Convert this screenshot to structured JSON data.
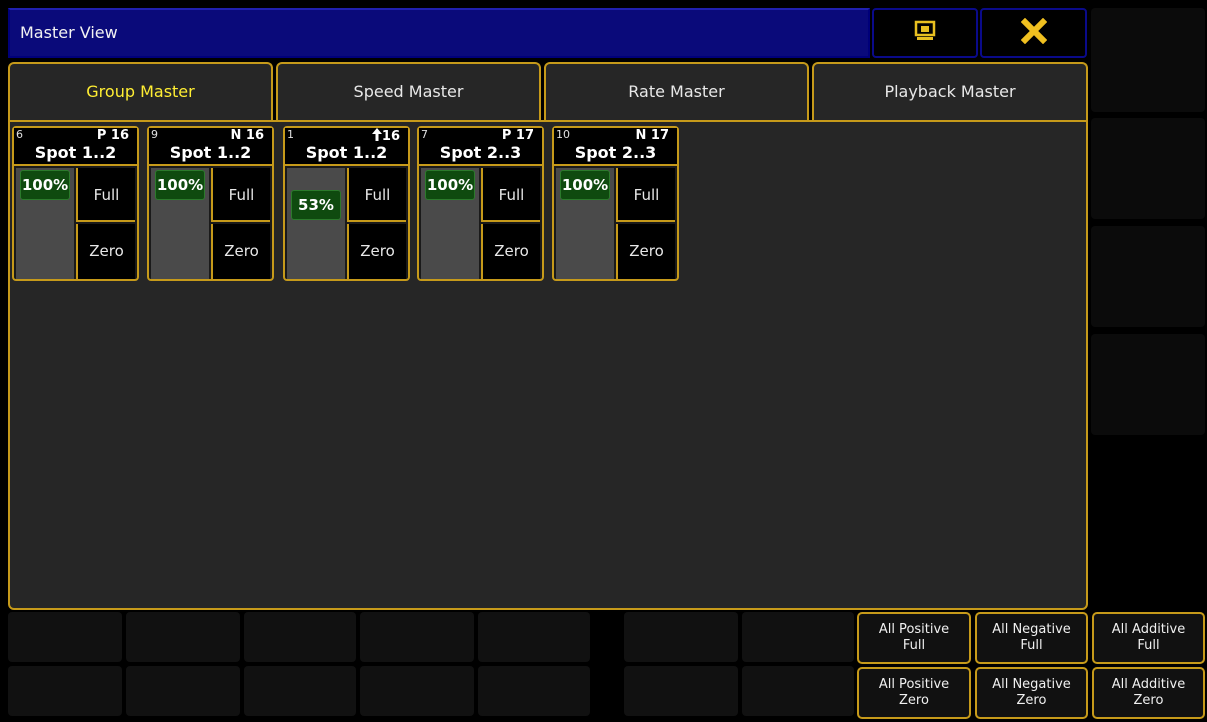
{
  "window": {
    "title": "Master View"
  },
  "title_buttons": {
    "capture_icon": "screen-capture-icon",
    "close_icon": "close-icon"
  },
  "tabs": [
    {
      "label": "Group Master",
      "active": true
    },
    {
      "label": "Speed Master",
      "active": false
    },
    {
      "label": "Rate Master",
      "active": false
    },
    {
      "label": "Playback Master",
      "active": false
    }
  ],
  "masters": [
    {
      "id": "6",
      "mode": "P 16",
      "name": "Spot 1..2",
      "value": "100%",
      "level": 1.0,
      "full": "Full",
      "zero": "Zero"
    },
    {
      "id": "9",
      "mode": "N 16",
      "name": "Spot 1..2",
      "value": "100%",
      "level": 1.0,
      "full": "Full",
      "zero": "Zero"
    },
    {
      "id": "1",
      "mode": "16",
      "mode_icon": "arrow-up-icon",
      "name": "Spot 1..2",
      "value": "53%",
      "level": 0.53,
      "full": "Full",
      "zero": "Zero"
    },
    {
      "id": "7",
      "mode": "P 17",
      "name": "Spot 2..3",
      "value": "100%",
      "level": 1.0,
      "full": "Full",
      "zero": "Zero"
    },
    {
      "id": "10",
      "mode": "N 17",
      "name": "Spot 2..3",
      "value": "100%",
      "level": 1.0,
      "full": "Full",
      "zero": "Zero"
    }
  ],
  "bottom_buttons": {
    "all_positive_full": [
      "All Positive",
      "Full"
    ],
    "all_negative_full": [
      "All Negative",
      "Full"
    ],
    "all_additive_full": [
      "All Additive",
      "Full"
    ],
    "all_positive_zero": [
      "All Positive",
      "Zero"
    ],
    "all_negative_zero": [
      "All Negative",
      "Zero"
    ],
    "all_additive_zero": [
      "All Additive",
      "Zero"
    ]
  },
  "colors": {
    "accent_border": "#c69a1a",
    "active_tab_text": "#ffee33",
    "title_bar": "#0a0a7a",
    "fader_value": "#0f4a0f"
  }
}
